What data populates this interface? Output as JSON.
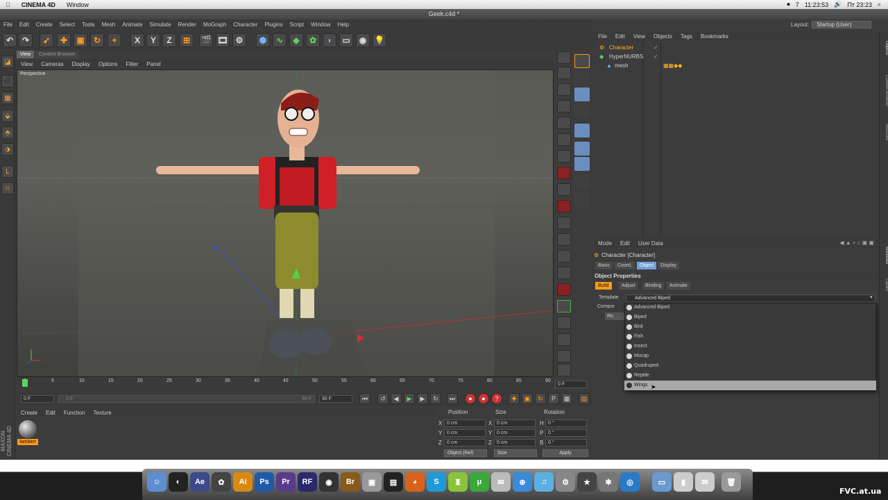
{
  "mac_menubar": {
    "app_name": "CINEMA 4D",
    "items": [
      "Window"
    ],
    "status": {
      "badge": "7",
      "clock_left": "11:23:53",
      "clock_right": "Пт 23:23"
    }
  },
  "window_title": "Geek.c4d *",
  "c4d_menu": [
    "File",
    "Edit",
    "Create",
    "Select",
    "Tools",
    "Mesh",
    "Animate",
    "Simulate",
    "Render",
    "MoGraph",
    "Character",
    "Plugins",
    "Script",
    "Window",
    "Help"
  ],
  "layout": {
    "label": "Layout:",
    "value": "Startup (User)"
  },
  "viewport": {
    "tabs": [
      "View",
      "Content Browser"
    ],
    "menu": [
      "View",
      "Cameras",
      "Display",
      "Options",
      "Filter",
      "Panel"
    ],
    "camera_label": "Perspective"
  },
  "timeline": {
    "ticks": [
      "0",
      "5",
      "10",
      "15",
      "20",
      "25",
      "30",
      "35",
      "40",
      "45",
      "50",
      "55",
      "60",
      "65",
      "70",
      "75",
      "80",
      "85",
      "90"
    ],
    "frame_end": "0 F",
    "start_field": "0 F",
    "end_field": "90 F",
    "slider_left": "0 F",
    "slider_right": "90 F"
  },
  "material_manager": {
    "menu": [
      "Create",
      "Edit",
      "Function",
      "Texture"
    ],
    "material_name": "lambert",
    "brand": "MAXON CINEMA 4D"
  },
  "coordinates": {
    "headers": {
      "position": "Position",
      "size": "Size",
      "rotation": "Rotation"
    },
    "rows": [
      {
        "ax": "X",
        "pos": "0 cm",
        "sax": "X",
        "size": "0 cm",
        "rax": "H",
        "rot": "0 °"
      },
      {
        "ax": "Y",
        "pos": "0 cm",
        "sax": "Y",
        "size": "0 cm",
        "rax": "P",
        "rot": "0 °"
      },
      {
        "ax": "Z",
        "pos": "0 cm",
        "sax": "Z",
        "size": "0 cm",
        "rax": "B",
        "rot": "0 °"
      }
    ],
    "mode": "Object (Rel)",
    "size_mode": "Size",
    "apply": "Apply"
  },
  "objects_manager": {
    "menu": [
      "File",
      "Edit",
      "View",
      "Objects",
      "Tags",
      "Bookmarks"
    ],
    "objects": [
      {
        "name": "Character",
        "color": "#ffb020"
      },
      {
        "name": "HyperNURBS",
        "color": "#cfcfcf"
      },
      {
        "name": "mesh",
        "color": "#cfcfcf"
      }
    ]
  },
  "attributes_manager": {
    "menu": [
      "Mode",
      "Edit",
      "User Data"
    ],
    "title": "Character [Character]",
    "tabs": [
      "Basic",
      "Coord.",
      "Object",
      "Display"
    ],
    "section": "Object Properties",
    "subtabs": [
      "Build",
      "Adjust",
      "Binding",
      "Animate"
    ],
    "template_label": "Template",
    "template_value": "Advanced Biped",
    "components_label": "Compor",
    "root_label": "Ro"
  },
  "template_dropdown": {
    "options": [
      "Advanced Biped",
      "Biped",
      "Bird",
      "Fish",
      "Insect",
      "Mocap",
      "Quadruped",
      "Reptile",
      "Wings"
    ],
    "highlighted": "Wings"
  },
  "right_tabs": [
    "Objects",
    "Content Browser",
    "Structure",
    "Attributes",
    "Layers"
  ],
  "dock": {
    "apps": [
      "Finder",
      "Cinema4D",
      "AfterEffects",
      "Kinect",
      "Illustrator",
      "Photoshop",
      "Premiere",
      "RealFlow",
      "Quicktime",
      "Bridge",
      "Preview",
      "Clapper",
      "Firefox",
      "Skype",
      "Android",
      "uTorrent",
      "Mail",
      "Safari",
      "iTunes",
      "SystemPrefs",
      "iMovie",
      "Utility",
      "AirDrop",
      "Folder",
      "Zip",
      "Mail2",
      "Trash"
    ],
    "watermark": "FVC.at.ua"
  },
  "accent_colors": {
    "orange": "#ff9a1a",
    "blue": "#6f9fd8",
    "green": "#5fd35f",
    "red": "#cc3333"
  }
}
